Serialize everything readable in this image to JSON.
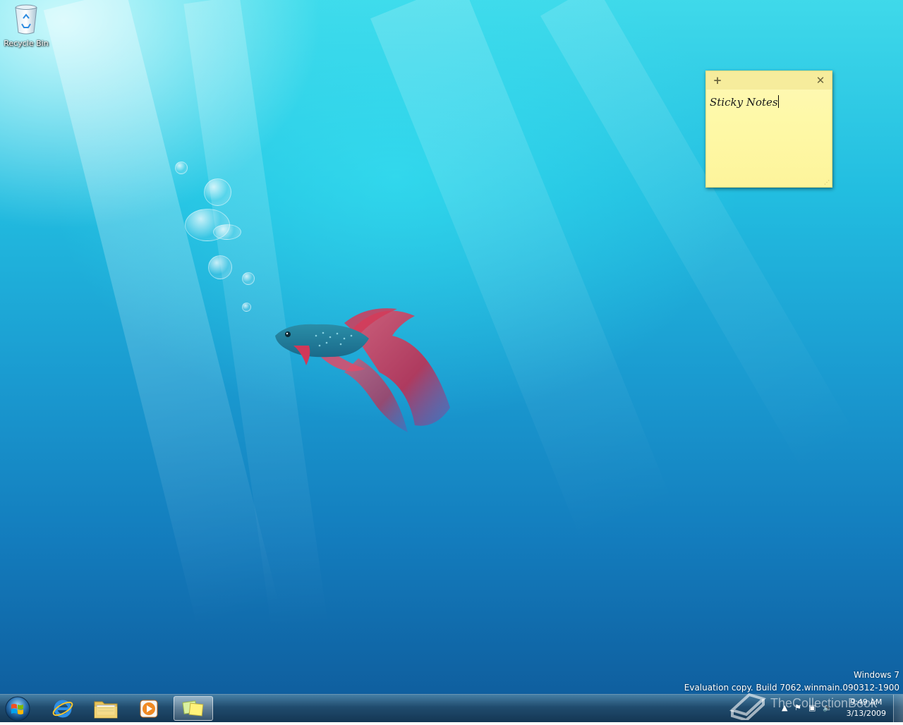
{
  "desktop": {
    "icons": [
      {
        "label": "Recycle Bin",
        "icon": "recycle-bin-icon"
      }
    ]
  },
  "sticky_note": {
    "text": "Sticky Notes",
    "add_symbol": "+",
    "close_symbol": "✕"
  },
  "os_watermark": {
    "line1": "Windows 7",
    "line2": "Evaluation copy. Build 7062.winmain.090312-1900"
  },
  "taskbar": {
    "pinned": [
      {
        "name": "Internet Explorer",
        "icon": "internet-explorer-icon"
      },
      {
        "name": "Windows Explorer",
        "icon": "folder-icon"
      },
      {
        "name": "Windows Media Player",
        "icon": "media-player-icon"
      },
      {
        "name": "Sticky Notes",
        "icon": "sticky-notes-icon",
        "active": true
      }
    ],
    "clock": {
      "time": "9:49 AM",
      "date": "3/13/2009"
    }
  },
  "site_watermark": "TheCollectionBook",
  "colors": {
    "note_bg": "#fef9a8",
    "taskbar": "#1e4a6e",
    "desktop_top": "#3fd9ea",
    "desktop_bottom": "#0f5f9f"
  }
}
